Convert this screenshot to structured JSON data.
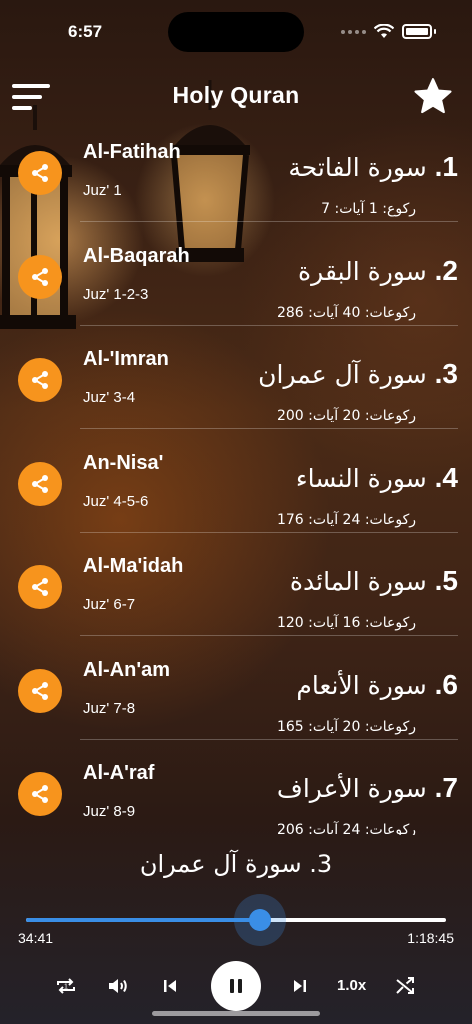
{
  "status_bar": {
    "time": "6:57"
  },
  "header": {
    "title": "Holy Quran"
  },
  "surahs": [
    {
      "number": "1.",
      "name_ar": "سورة الفاتحة",
      "meta_ar": "ركوع: 1  آيات: 7",
      "name_en": "Al-Fatihah",
      "juz": "Juz' 1"
    },
    {
      "number": "2.",
      "name_ar": "سورة البقرة",
      "meta_ar": "ركوعات: 40  آيات: 286",
      "name_en": "Al-Baqarah",
      "juz": "Juz' 1-2-3"
    },
    {
      "number": "3.",
      "name_ar": "سورة آل عمران",
      "meta_ar": "ركوعات: 20  آيات: 200",
      "name_en": "Al-'Imran",
      "juz": "Juz' 3-4"
    },
    {
      "number": "4.",
      "name_ar": "سورة النساء",
      "meta_ar": "ركوعات: 24  آيات: 176",
      "name_en": "An-Nisa'",
      "juz": "Juz' 4-5-6"
    },
    {
      "number": "5.",
      "name_ar": "سورة المائدة",
      "meta_ar": "ركوعات: 16  آيات: 120",
      "name_en": "Al-Ma'idah",
      "juz": "Juz' 6-7"
    },
    {
      "number": "6.",
      "name_ar": "سورة الأنعام",
      "meta_ar": "ركوعات: 20  آيات: 165",
      "name_en": "Al-An'am",
      "juz": "Juz' 7-8"
    },
    {
      "number": "7.",
      "name_ar": "سورة الأعراف",
      "meta_ar": "ركوعات: 24  آيات: 206",
      "name_en": "Al-A'raf",
      "juz": "Juz' 8-9"
    }
  ],
  "player": {
    "now_playing": "3. سورة آل عمران",
    "elapsed": "34:41",
    "total": "1:18:45",
    "progress_fraction": 0.556,
    "speed": "1.0x",
    "accent": "#3a8ee6"
  },
  "colors": {
    "share_button": "#f7941d"
  },
  "icons": [
    "menu-icon",
    "star-icon",
    "share-icon",
    "repeat-icon",
    "volume-icon",
    "previous-icon",
    "pause-icon",
    "next-icon",
    "shuffle-icon"
  ]
}
